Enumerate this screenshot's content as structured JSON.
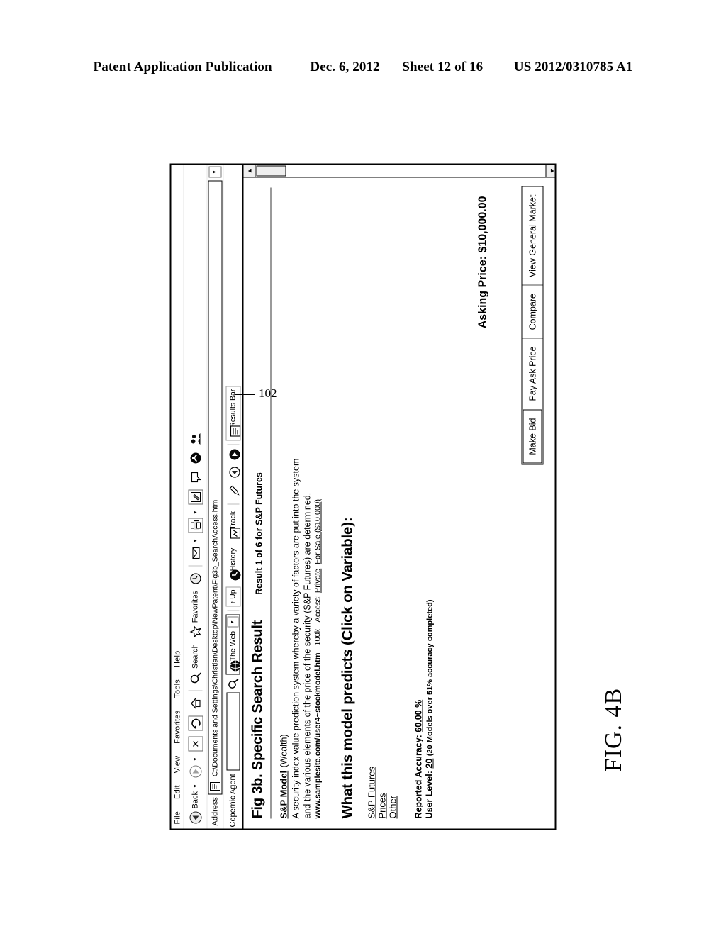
{
  "patent_header": {
    "publication": "Patent Application Publication",
    "date": "Dec. 6, 2012",
    "sheet": "Sheet 12 of 16",
    "number": "US 2012/0310785 A1"
  },
  "figure": {
    "label": "FIG. 4B",
    "reference_numeral": "102"
  },
  "browser": {
    "menu": [
      {
        "label": "File"
      },
      {
        "label": "Edit"
      },
      {
        "label": "View"
      },
      {
        "label": "Favorites"
      },
      {
        "label": "Tools"
      },
      {
        "label": "Help"
      }
    ],
    "toolbar": {
      "back_label": "Back",
      "back_icon": "back-arrow-icon",
      "forward_icon": "forward-arrow-icon",
      "stop_icon": "stop-icon",
      "refresh_icon": "refresh-icon",
      "home_icon": "home-icon",
      "search_label": "Search",
      "search_icon": "search-magnifier-icon",
      "favorites_label": "Favorites",
      "favorites_icon": "favorites-star-icon",
      "history_icon": "history-clock-icon",
      "mail_icon": "mail-icon",
      "print_icon": "print-icon",
      "edit_icon": "edit-page-icon",
      "discuss_icon": "discuss-icon",
      "messenger_icon": "messenger-icon",
      "media_icon": "media-icon",
      "people_icon": "people-icon"
    },
    "address": {
      "label": "Address",
      "value": "C:\\Documents and Settings\\Christian\\Desktop\\NewPatent\\Fig3b_SearchAccess.htm",
      "doc_icon": "document-icon",
      "dropdown_icon": "chevron-down-icon"
    },
    "copernic": {
      "label": "Copernic Agent",
      "query": "",
      "query_placeholder": "",
      "search_icon": "search-magnifier-icon",
      "scope_label": "The Web",
      "scope_icon": "globe-icon",
      "scope_dropdown_icon": "chevron-down-icon",
      "up_label": "Up",
      "up_icon": "up-arrow-icon",
      "history_label": "History",
      "history_icon": "history-clock-icon",
      "track_label": "Track",
      "track_icon": "track-icon",
      "highlight_icon": "highlight-pen-icon",
      "prev_icon": "previous-circle-icon",
      "next_icon": "next-circle-icon",
      "results_bar_label": "Results Bar",
      "results_bar_icon": "results-bar-icon"
    },
    "scrollbar": {
      "up_icon": "scroll-up-arrow-icon",
      "down_icon": "scroll-down-arrow-icon"
    }
  },
  "page": {
    "title": "Fig 3b. Specific Search Result",
    "result_count": "Result 1 of  6 for S&P Futures",
    "model": {
      "name": "S&P Model",
      "category": "(Wealth)",
      "description": "A security index value prediction system whereby a variety of factors are put into the system and the various elements of the price of the security (S&P Futures) are determined.",
      "url": "www.samplesite.com/user4~stockmodel.htm",
      "size": "100k",
      "access_label": "Access:",
      "access_value": "Private",
      "for_sale": "For Sale ($10,000)"
    },
    "predicts_heading": "What this model predicts (Click on Variable):",
    "variables": [
      {
        "label": "S&P Futures"
      },
      {
        "label": "Prices"
      },
      {
        "label": "Other"
      }
    ],
    "accuracy_label": "Reported Accuracy:",
    "accuracy_value": "60.00 %",
    "user_level_label": "User Level:",
    "user_level_value": "20",
    "user_level_note": "(20 Models over 51% accuracy completed)",
    "asking_price": "Asking Price: $10,000.00",
    "buttons": [
      {
        "label": "Make Bid"
      },
      {
        "label": "Pay Ask Price"
      },
      {
        "label": "Compare"
      },
      {
        "label": "View General Market"
      }
    ]
  }
}
